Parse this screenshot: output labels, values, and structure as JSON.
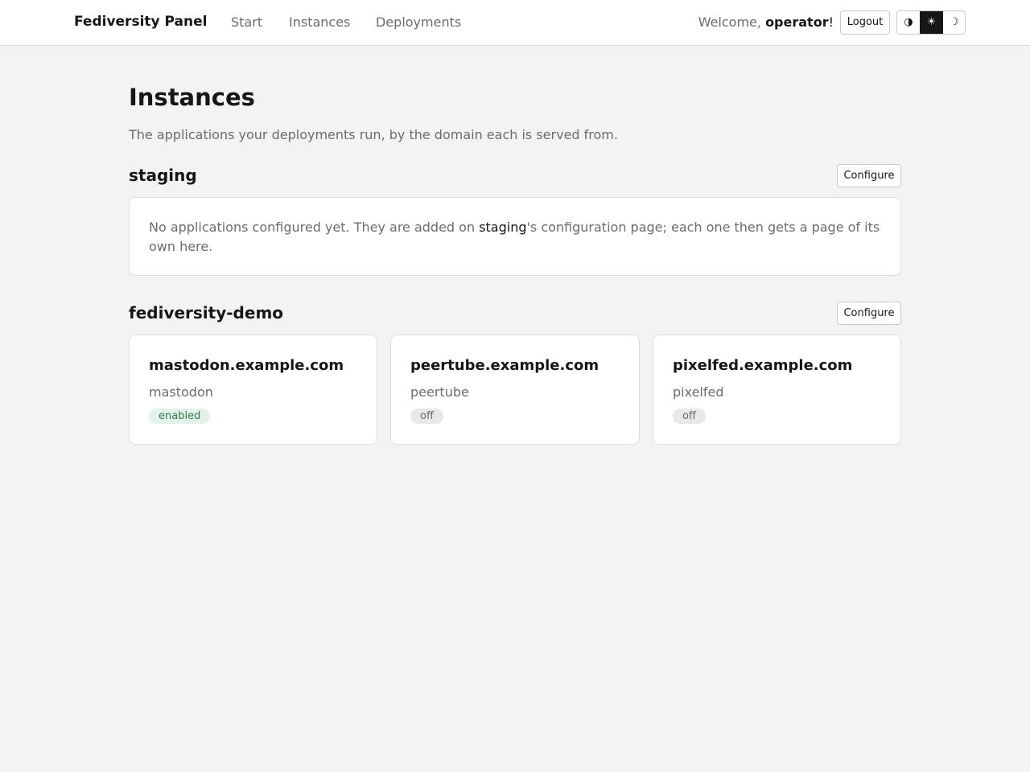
{
  "header": {
    "brand": "Fediversity Panel",
    "nav": [
      "Start",
      "Instances",
      "Deployments"
    ],
    "welcome_prefix": "Welcome,",
    "username": "operator",
    "welcome_suffix": "!",
    "logout_label": "Logout",
    "theme_options": [
      {
        "glyph": "◑",
        "icon": "auto-theme-icon"
      },
      {
        "glyph": "☀",
        "icon": "sun-icon"
      },
      {
        "glyph": "☽",
        "icon": "moon-icon"
      }
    ],
    "active_theme_index": 1
  },
  "page": {
    "title": "Instances",
    "subtitle": "The applications your deployments run, by the domain each is served from."
  },
  "deployments": [
    {
      "name": "staging",
      "configure_label": "Configure",
      "empty_text_before": "No applications configured yet. They are added on ",
      "empty_text_name": "staging",
      "empty_text_after": "'s configuration page; each one then gets a page of its own here."
    },
    {
      "name": "fediversity-demo",
      "configure_label": "Configure",
      "instances": [
        {
          "domain": "mastodon.example.com",
          "app": "mastodon",
          "status": "enabled"
        },
        {
          "domain": "peertube.example.com",
          "app": "peertube",
          "status": "off"
        },
        {
          "domain": "pixelfed.example.com",
          "app": "pixelfed",
          "status": "off"
        }
      ]
    }
  ],
  "colors": {
    "background": "#f3f3f3",
    "enabled_badge_bg": "#e3f3e9",
    "enabled_badge_fg": "#2f7a4a",
    "off_badge_bg": "#e8e8e8"
  }
}
